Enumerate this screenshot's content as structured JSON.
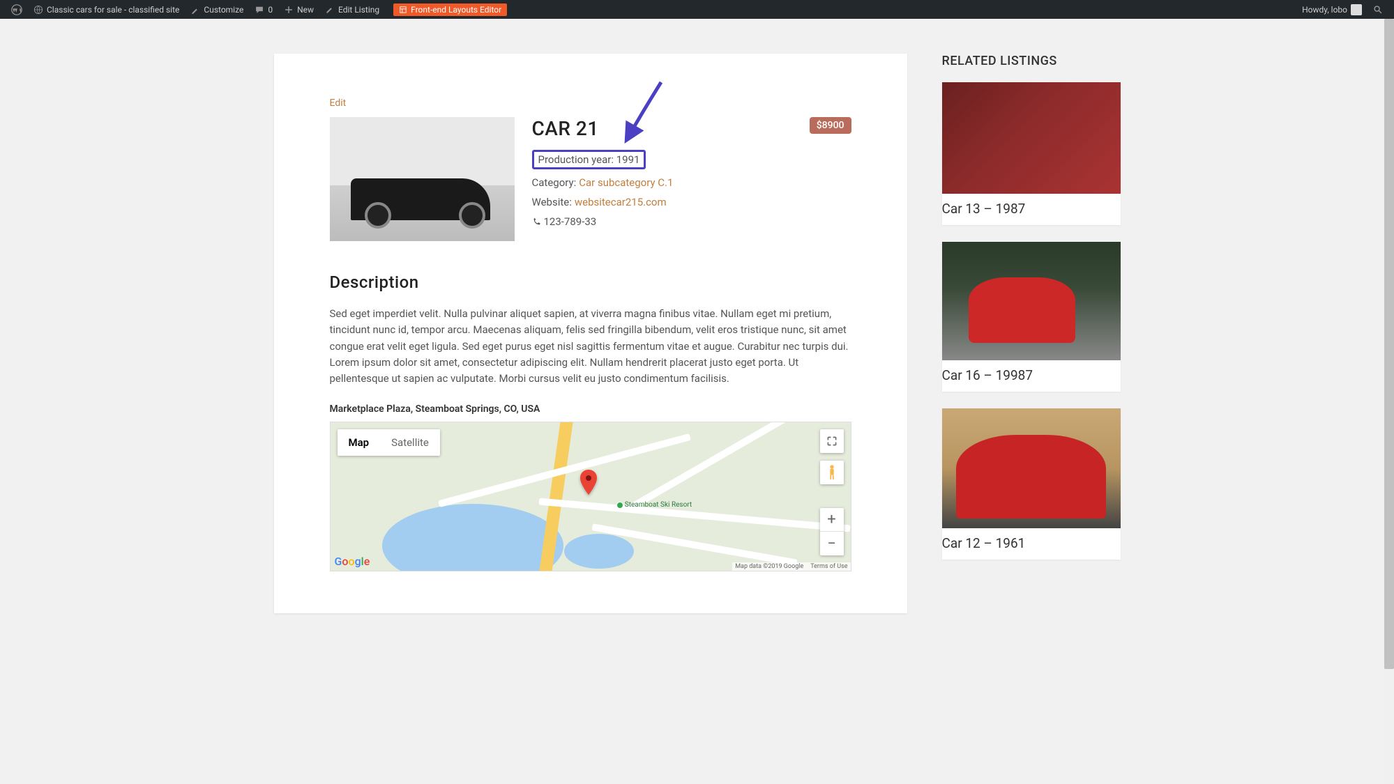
{
  "adminBar": {
    "siteName": "Classic cars for sale - classified site",
    "customize": "Customize",
    "comments": "0",
    "new": "New",
    "editListing": "Edit Listing",
    "layoutsEditor": "Front-end Layouts Editor",
    "howdy": "Howdy, lobo"
  },
  "listing": {
    "edit": "Edit",
    "title": "CAR 21",
    "price": "$8900",
    "productionYearLabel": "Production year: ",
    "productionYear": "1991",
    "categoryLabel": "Category: ",
    "category": "Car subcategory C.1",
    "websiteLabel": "Website: ",
    "website": "websitecar215.com",
    "phone": "123-789-33",
    "descHeading": "Description",
    "descBody": "Sed eget imperdiet velit. Nulla pulvinar aliquet sapien, at viverra magna finibus vitae. Nullam eget mi pretium, tincidunt nunc id, tempor arcu. Maecenas aliquam, felis sed fringilla bibendum, velit eros tristique nunc, sit amet congue erat velit eget ligula. Sed eget purus eget nisl sagittis fermentum vitae et augue. Curabitur nec turpis dui. Lorem ipsum dolor sit amet, consectetur adipiscing elit. Nullam hendrerit placerat justo eget porta. Ut pellentesque ut sapien ac vulputate. Morbi cursus velit eu justo condimentum facilisis.",
    "address": "Marketplace Plaza, Steamboat Springs, CO, USA"
  },
  "map": {
    "tabMap": "Map",
    "tabSatellite": "Satellite",
    "poi": "Steamboat Ski Resort",
    "attrData": "Map data ©2019 Google",
    "attrTerms": "Terms of Use",
    "zoomIn": "+",
    "zoomOut": "−"
  },
  "sidebar": {
    "heading": "RELATED LISTINGS",
    "items": [
      {
        "title": "Car 13 – 1987"
      },
      {
        "title": "Car 16 – 19987"
      },
      {
        "title": "Car 12 – 1961"
      }
    ]
  }
}
